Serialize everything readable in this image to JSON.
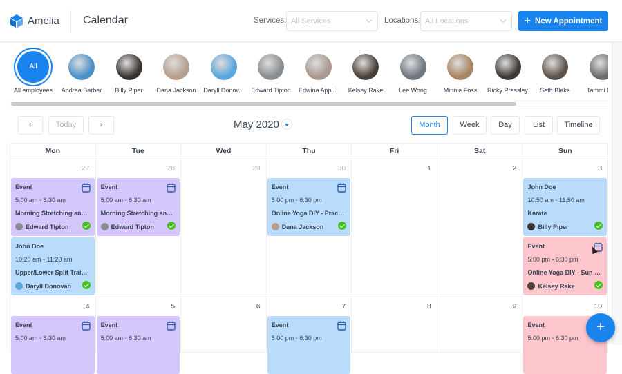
{
  "header": {
    "brand": "Amelia",
    "title": "Calendar",
    "services_label": "Services:",
    "services_placeholder": "All Services",
    "locations_label": "Locations:",
    "locations_placeholder": "All Locations",
    "new_appointment": "New Appointment"
  },
  "employees": {
    "all_badge": "All",
    "all_label": "All employees",
    "list": [
      {
        "name": "Andrea Barber",
        "color": "#4a90c9"
      },
      {
        "name": "Billy Piper",
        "color": "#3a3230"
      },
      {
        "name": "Dana Jackson",
        "color": "#b59e8c"
      },
      {
        "name": "Daryll Donov...",
        "color": "#5aa7dc"
      },
      {
        "name": "Edward Tipton",
        "color": "#8a8d90"
      },
      {
        "name": "Edwina Appl...",
        "color": "#a89890"
      },
      {
        "name": "Kelsey Rake",
        "color": "#4a4038"
      },
      {
        "name": "Lee Wong",
        "color": "#6f7780"
      },
      {
        "name": "Minnie Foss",
        "color": "#a88460"
      },
      {
        "name": "Ricky Pressley",
        "color": "#3d3834"
      },
      {
        "name": "Seth Blake",
        "color": "#5d5249"
      },
      {
        "name": "Tammi Duk",
        "color": "#6a6a6a"
      }
    ]
  },
  "toolbar": {
    "prev": "‹",
    "today": "Today",
    "next": "›",
    "month_title": "May 2020",
    "views": [
      "Month",
      "Week",
      "Day",
      "List",
      "Timeline"
    ],
    "active_view": "Month"
  },
  "calendar": {
    "weekdays": [
      "Mon",
      "Tue",
      "Wed",
      "Thu",
      "Fri",
      "Sat",
      "Sun"
    ],
    "week1": {
      "days": [
        "27",
        "28",
        "29",
        "30",
        "1",
        "2",
        "3"
      ],
      "events": {
        "mon_a": {
          "title": "Event",
          "time": "5:00 am - 6:30 am",
          "service": "Morning Stretching and R...",
          "employee": "Edward Tipton"
        },
        "mon_b": {
          "title": "John Doe",
          "time": "10:20 am - 11:20 am",
          "service": "Upper/Lower Split Training",
          "employee": "Daryll Donovan"
        },
        "tue_a": {
          "title": "Event",
          "time": "5:00 am - 6:30 am",
          "service": "Morning Stretching and R...",
          "employee": "Edward Tipton"
        },
        "thu_a": {
          "title": "Event",
          "time": "5:00 pm - 6:30 pm",
          "service": "Online Yoga DIY - Practice...",
          "employee": "Dana Jackson"
        },
        "sun_a": {
          "title": "John Doe",
          "time": "10:50 am - 11:50 am",
          "service": "Karate",
          "employee": "Billy Piper"
        },
        "sun_b": {
          "title": "Event",
          "time": "5:00 pm - 6:30 pm",
          "service": "Online Yoga DIY - Sun and...",
          "employee": "Kelsey Rake"
        }
      }
    },
    "week2": {
      "days": [
        "4",
        "5",
        "6",
        "7",
        "8",
        "9",
        "10"
      ],
      "events": {
        "mon_a": {
          "title": "Event",
          "time": "5:00 am - 6:30 am"
        },
        "tue_a": {
          "title": "Event",
          "time": "5:00 am - 6:30 am"
        },
        "thu_a": {
          "title": "Event",
          "time": "5:00 pm - 6:30 pm"
        },
        "sun_a": {
          "title": "Event",
          "time": "5:00 pm - 6:30 pm"
        }
      }
    }
  },
  "fab": "+"
}
